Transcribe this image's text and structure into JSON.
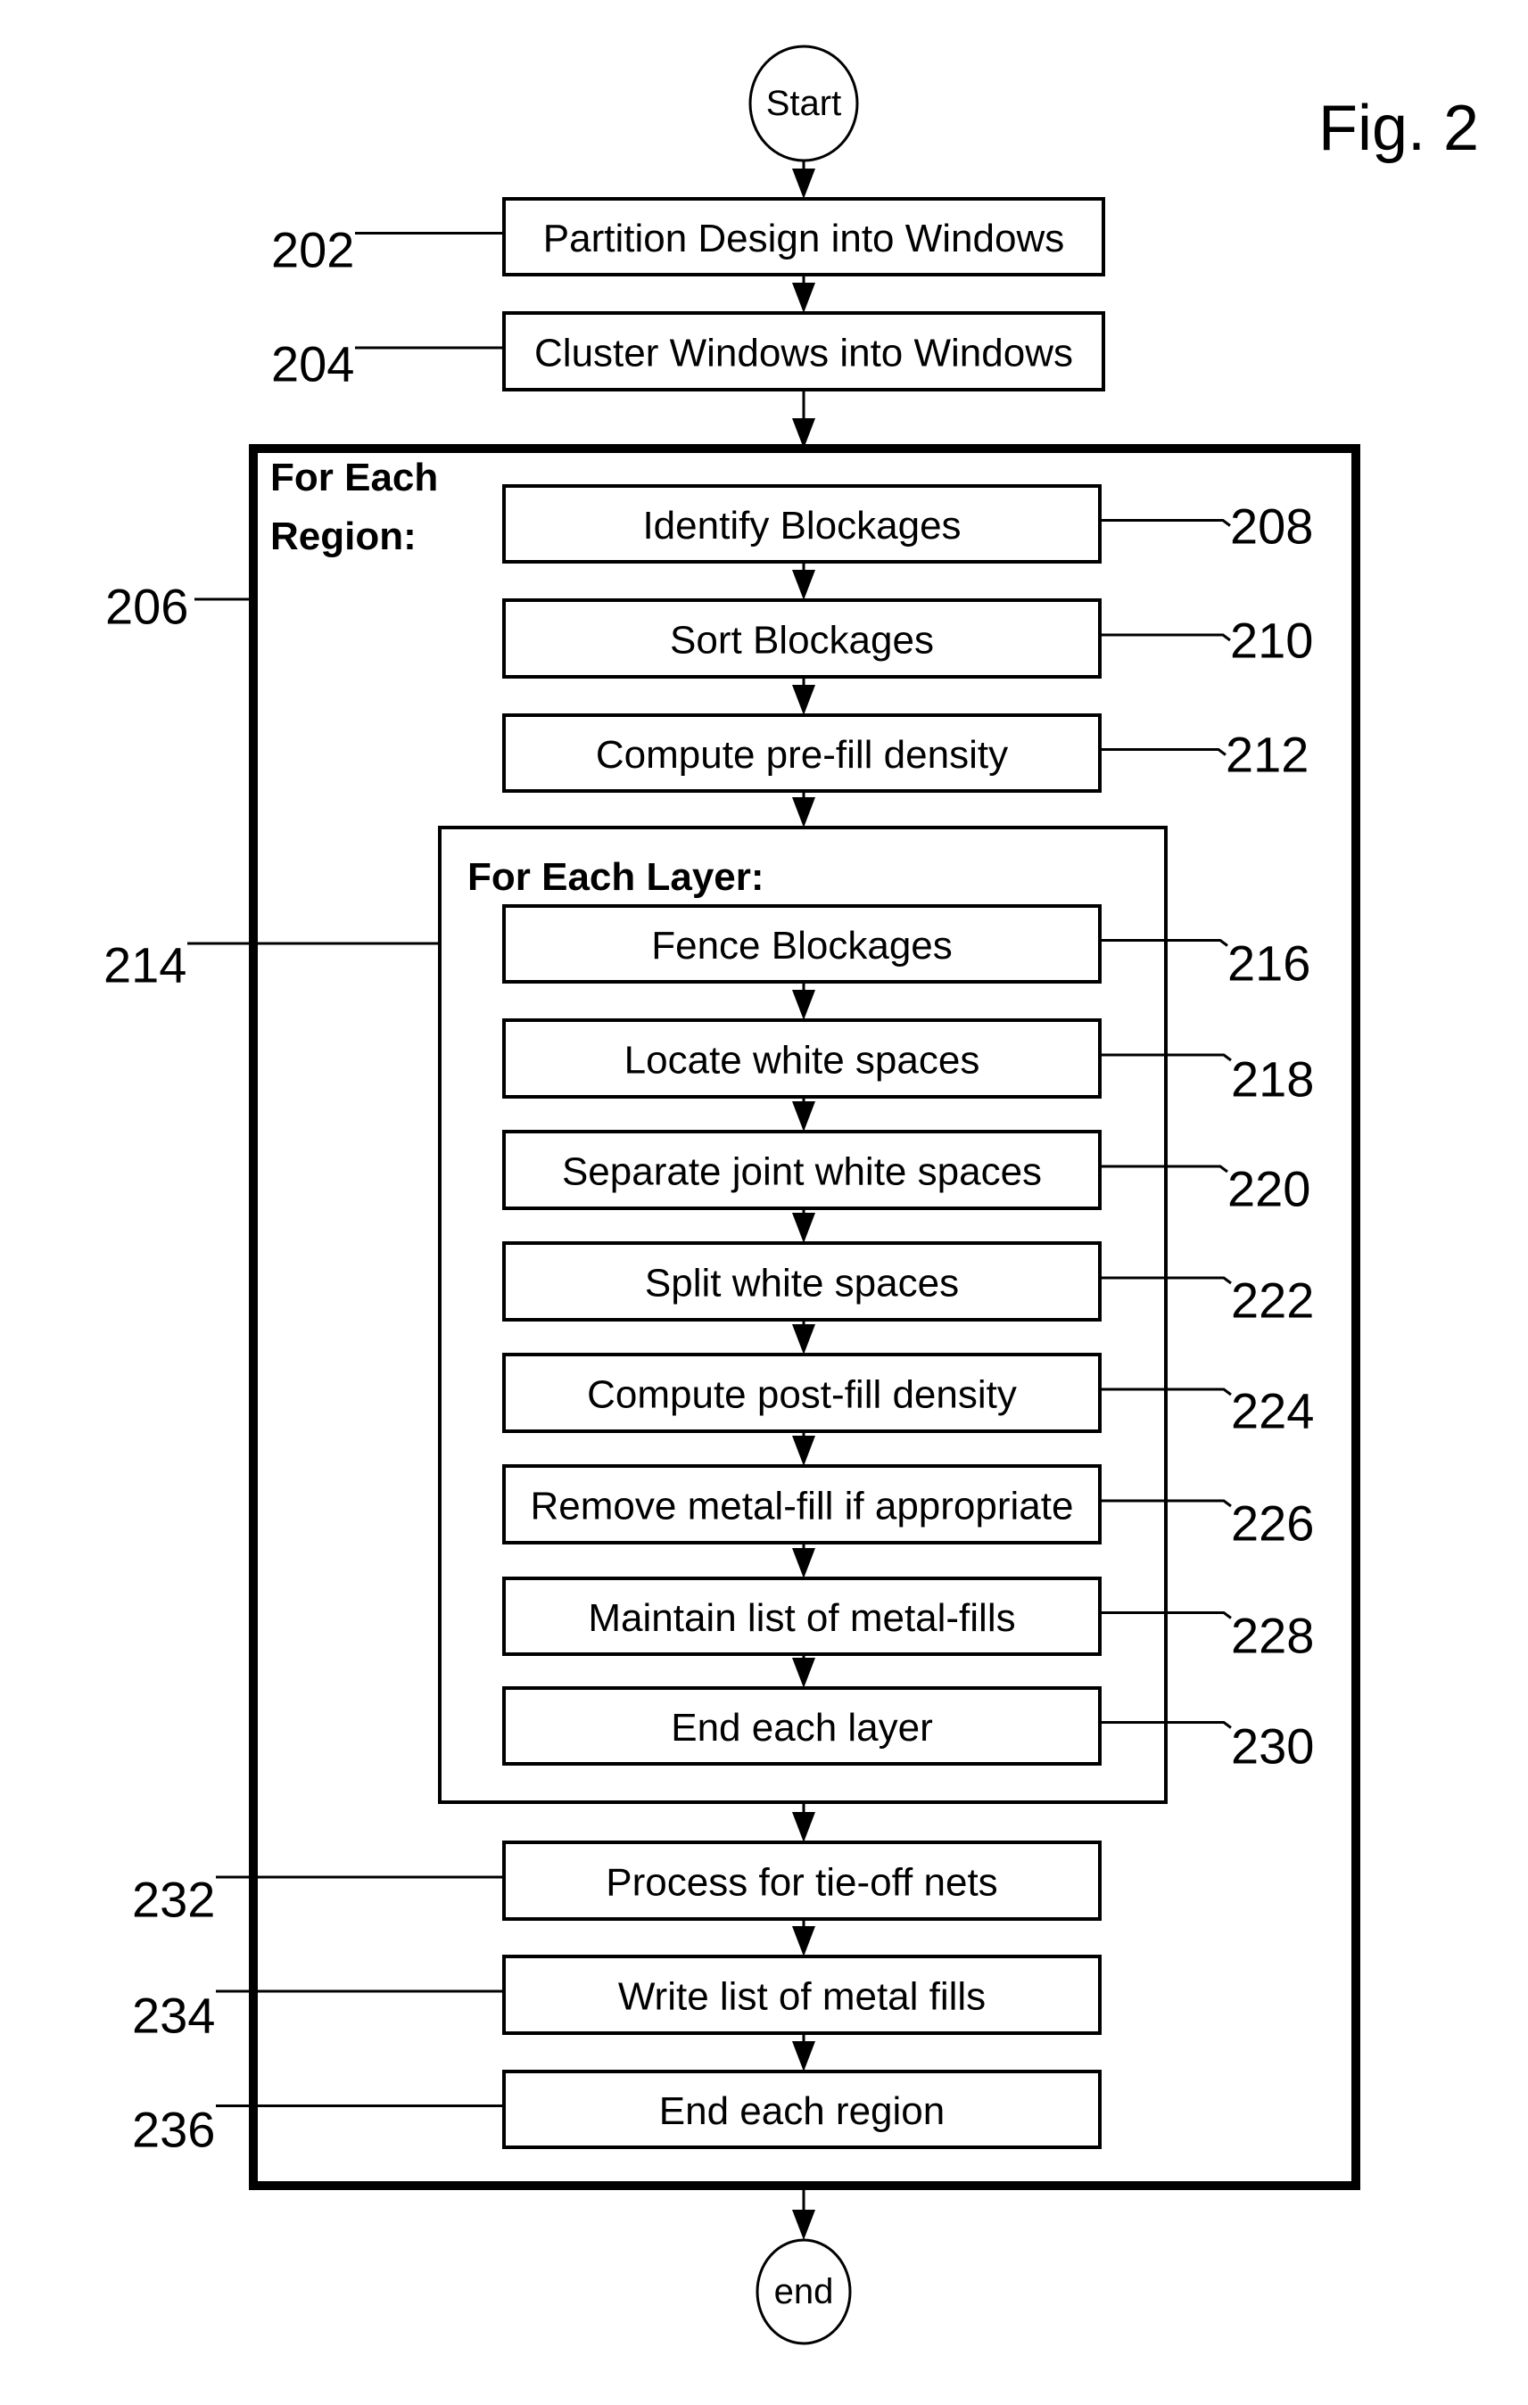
{
  "figure_label": "Fig. 2",
  "start": {
    "label": "Start"
  },
  "end": {
    "label": "end"
  },
  "pre_steps": [
    {
      "ref": "202",
      "label": "Partition Design into Windows"
    },
    {
      "ref": "204",
      "label": "Cluster Windows into Windows"
    }
  ],
  "region_loop": {
    "ref": "206",
    "title_line1": "For Each",
    "title_line2": "Region:",
    "steps_before_layer": [
      {
        "ref": "208",
        "label": "Identify Blockages"
      },
      {
        "ref": "210",
        "label": "Sort Blockages"
      },
      {
        "ref": "212",
        "label": "Compute pre-fill density"
      }
    ],
    "layer_loop": {
      "ref": "214",
      "title": "For Each Layer:",
      "steps": [
        {
          "ref": "216",
          "label": "Fence Blockages"
        },
        {
          "ref": "218",
          "label": "Locate white spaces"
        },
        {
          "ref": "220",
          "label": "Separate joint white spaces"
        },
        {
          "ref": "222",
          "label": "Split white spaces"
        },
        {
          "ref": "224",
          "label": "Compute post-fill density"
        },
        {
          "ref": "226",
          "label": "Remove metal-fill if appropriate"
        },
        {
          "ref": "228",
          "label": "Maintain list of metal-fills"
        },
        {
          "ref": "230",
          "label": "End each layer"
        }
      ]
    },
    "steps_after_layer": [
      {
        "ref": "232",
        "label": "Process for tie-off nets"
      },
      {
        "ref": "234",
        "label": "Write list of metal fills"
      },
      {
        "ref": "236",
        "label": "End each region"
      }
    ]
  }
}
